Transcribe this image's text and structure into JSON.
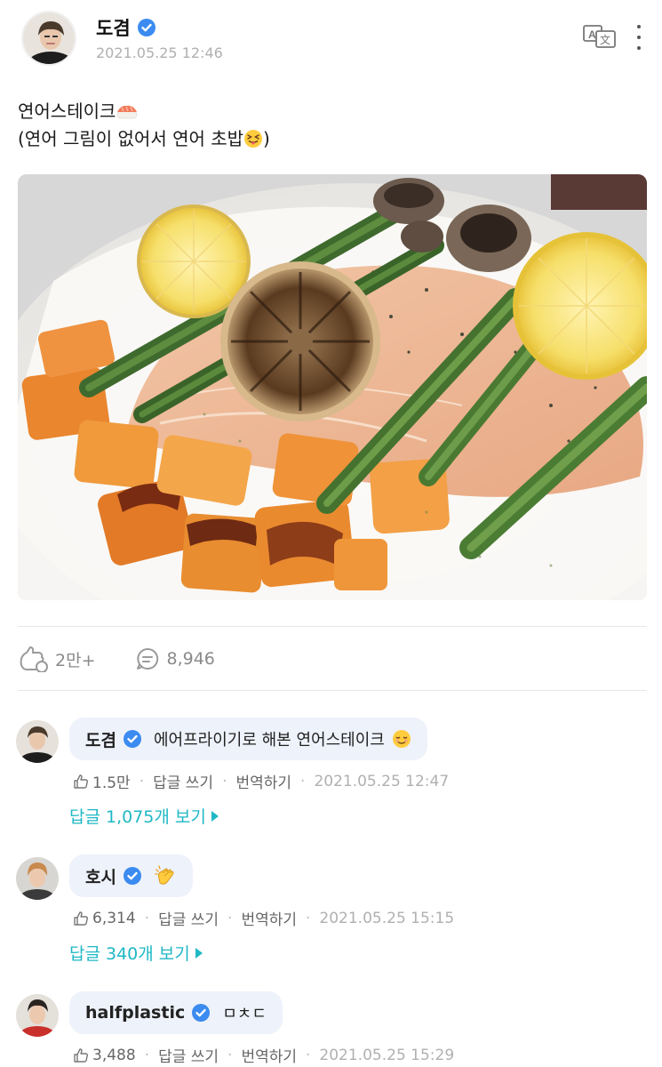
{
  "post": {
    "author": "도겸",
    "date": "2021.05.25 12:46",
    "text_line1": "연어스테이크",
    "text_line2_a": "(연어 그림이 없어서 연어 초밥",
    "text_line2_b": ")"
  },
  "stats": {
    "likes": "2만+",
    "comments": "8,946"
  },
  "comments": [
    {
      "name": "도겸",
      "text": "에어프라이기로 해본 연어스테이크",
      "likes": "1.5만",
      "reply_label": "답글 쓰기",
      "translate_label": "번역하기",
      "date": "2021.05.25 12:47",
      "view_replies": "답글 1,075개 보기"
    },
    {
      "name": "호시",
      "text": "",
      "likes": "6,314",
      "reply_label": "답글 쓰기",
      "translate_label": "번역하기",
      "date": "2021.05.25 15:15",
      "view_replies": "답글 340개 보기"
    },
    {
      "name": "halfplastic",
      "text": "ㅁㅊㄷ",
      "likes": "3,488",
      "reply_label": "답글 쓰기",
      "translate_label": "번역하기",
      "date": "2021.05.25 15:29"
    }
  ],
  "icons": {
    "verified": "verified-badge-icon",
    "translate": "translate-icon",
    "more": "more-vertical-icon",
    "like": "thumbs-up-icon",
    "comment": "comment-bubble-icon"
  },
  "colors": {
    "accent": "#1fb8c5",
    "verified": "#3b8bf0",
    "bubble": "#eef2fb"
  }
}
